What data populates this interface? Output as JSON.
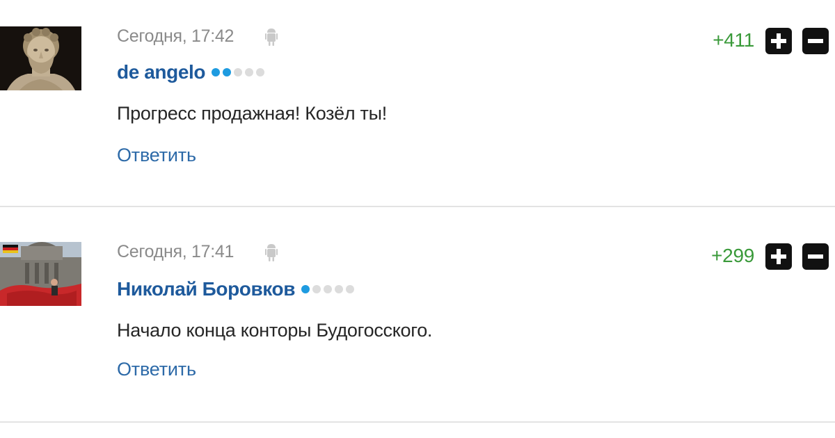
{
  "comments": [
    {
      "timestamp": "Сегодня, 17:42",
      "device_icon": "android-icon",
      "author": "de angelo",
      "rating_dots": {
        "filled": 2,
        "total": 5
      },
      "text": "Прогресс продажная! Козёл ты!",
      "reply_label": "Ответить",
      "score": "+411",
      "avatar": "bust-statue-avatar"
    },
    {
      "timestamp": "Сегодня, 17:41",
      "device_icon": "android-icon",
      "author": "Николай Боровков",
      "rating_dots": {
        "filled": 1,
        "total": 5
      },
      "text": "Начало конца конторы Будогосского.",
      "reply_label": "Ответить",
      "score": "+299",
      "avatar": "reichstag-flag-avatar"
    }
  ],
  "vote": {
    "plus_icon": "plus-icon",
    "minus_icon": "minus-icon"
  },
  "colors": {
    "author": "#1e5a9c",
    "reply": "#2d6aa8",
    "score": "#3a9a3a",
    "timestamp": "#8a8a8a",
    "dot_on": "#1e9be0",
    "dot_off": "#dcdcdc",
    "vote_button": "#111111"
  }
}
